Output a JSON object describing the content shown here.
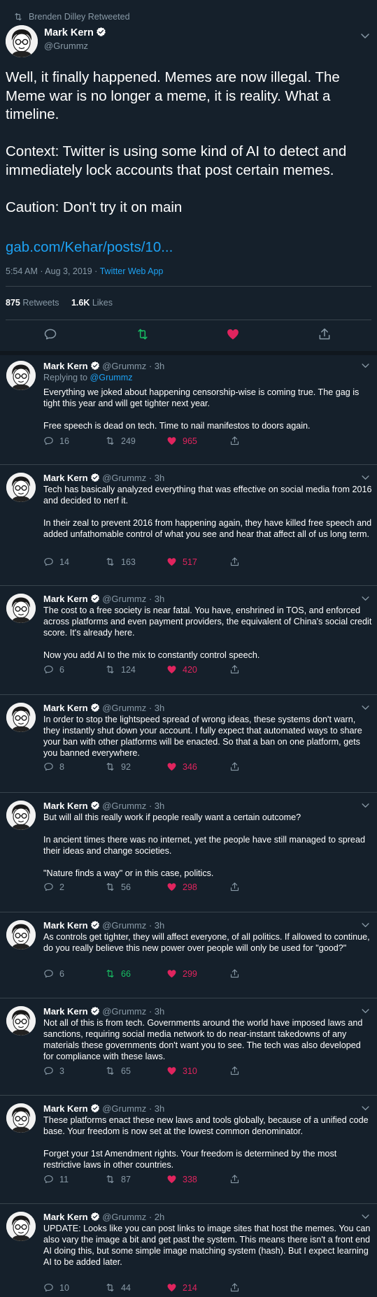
{
  "retweet_label": "Brenden Dilley Retweeted",
  "main_tweet": {
    "name": "Mark Kern",
    "handle": "@Grummz",
    "text": "Well, it finally happened. Memes are now illegal. The Meme war is no longer a meme, it is reality. What a timeline.\n\nContext: Twitter is using some kind of AI to detect and immediately lock accounts that post certain memes.\n\nCaution: Don't try it on main",
    "link": "gab.com/Kehar/posts/10...",
    "timestamp": "5:54 AM · Aug 3, 2019 · ",
    "source": "Twitter Web App",
    "retweets_count": "875",
    "retweets_label": "Retweets",
    "likes_count": "1.6K",
    "likes_label": "Likes"
  },
  "replies": [
    {
      "name": "Mark Kern",
      "handle": "@Grummz · 3h",
      "replying_prefix": "Replying to ",
      "replying_handle": "@Grummz",
      "text": "Everything we joked about happening censorship-wise is coming true. The gag is tight this year and will get tighter next year.\n\nFree speech is dead on tech. Time to nail manifestos to doors again.",
      "replies": "16",
      "retweets": "249",
      "likes": "965"
    },
    {
      "name": "Mark Kern",
      "handle": "@Grummz · 3h",
      "text": "Tech has basically analyzed everything that was effective on social media from 2016 and decided to nerf it.\n\nIn their zeal to prevent 2016 from happening again, they have killed free speech and added unfathomable control of what you see and hear that affect all of us long term.",
      "replies": "14",
      "retweets": "163",
      "likes": "517"
    },
    {
      "name": "Mark Kern",
      "handle": "@Grummz · 3h",
      "text": "The cost to a free society is near fatal. You have, enshrined in TOS, and enforced across platforms and even payment providers, the equivalent of China's social credit score. It's already here.\n\nNow you add AI to the mix to constantly control speech.",
      "replies": "6",
      "retweets": "124",
      "likes": "420"
    },
    {
      "name": "Mark Kern",
      "handle": "@Grummz · 3h",
      "text": "In order to stop the lightspeed spread of wrong ideas, these systems don't warn, they instantly shut down your account. I fully expect that automated ways to share your ban with other platforms will be enacted. So that a ban on one platform, gets you banned everywhere.",
      "replies": "8",
      "retweets": "92",
      "likes": "346"
    },
    {
      "name": "Mark Kern",
      "handle": "@Grummz · 3h",
      "text": "But will all this really work if people really want a certain outcome?\n\nIn ancient times there was no internet, yet the people have still managed to spread their ideas and change societies.\n\n\"Nature finds a way\" or in this case, politics.",
      "replies": "2",
      "retweets": "56",
      "likes": "298"
    },
    {
      "name": "Mark Kern",
      "handle": "@Grummz · 3h",
      "text": "As controls get tighter, they will affect everyone, of all politics. If allowed to continue, do you really believe this new power over people will only be used for \"good?\"",
      "replies": "6",
      "retweets": "66",
      "likes": "299"
    },
    {
      "name": "Mark Kern",
      "handle": "@Grummz · 3h",
      "text": "Not all of this is from tech. Governments around the world have imposed laws and sanctions, requiring social media network to do near-instant takedowns of any materials these governments don't want you to see. The tech was also developed for compliance with these laws.",
      "replies": "3",
      "retweets": "65",
      "likes": "310"
    },
    {
      "name": "Mark Kern",
      "handle": "@Grummz · 3h",
      "text": "These platforms enact these new laws and tools globally, because of a unified code base. Your freedom is now set at the lowest common denominator.\n\nForget your 1st Amendment rights. Your freedom is determined by the most restrictive laws in other countries.",
      "replies": "11",
      "retweets": "87",
      "likes": "338"
    },
    {
      "name": "Mark Kern",
      "handle": "@Grummz · 2h",
      "text": "UPDATE: Looks like you can post links to image sites that host the memes. You can also vary the image a bit and get past the system. This means there isn't a front end AI doing this, but some simple image matching system (hash). But I expect learning AI to be added later.",
      "replies": "10",
      "retweets": "44",
      "likes": "214"
    }
  ],
  "colors": {
    "background": "#15202b",
    "secondary_text": "#8899a6",
    "link": "#1da1f2",
    "like": "#e0245e",
    "retweet_active": "#17bf63",
    "separator": "#38444d"
  }
}
